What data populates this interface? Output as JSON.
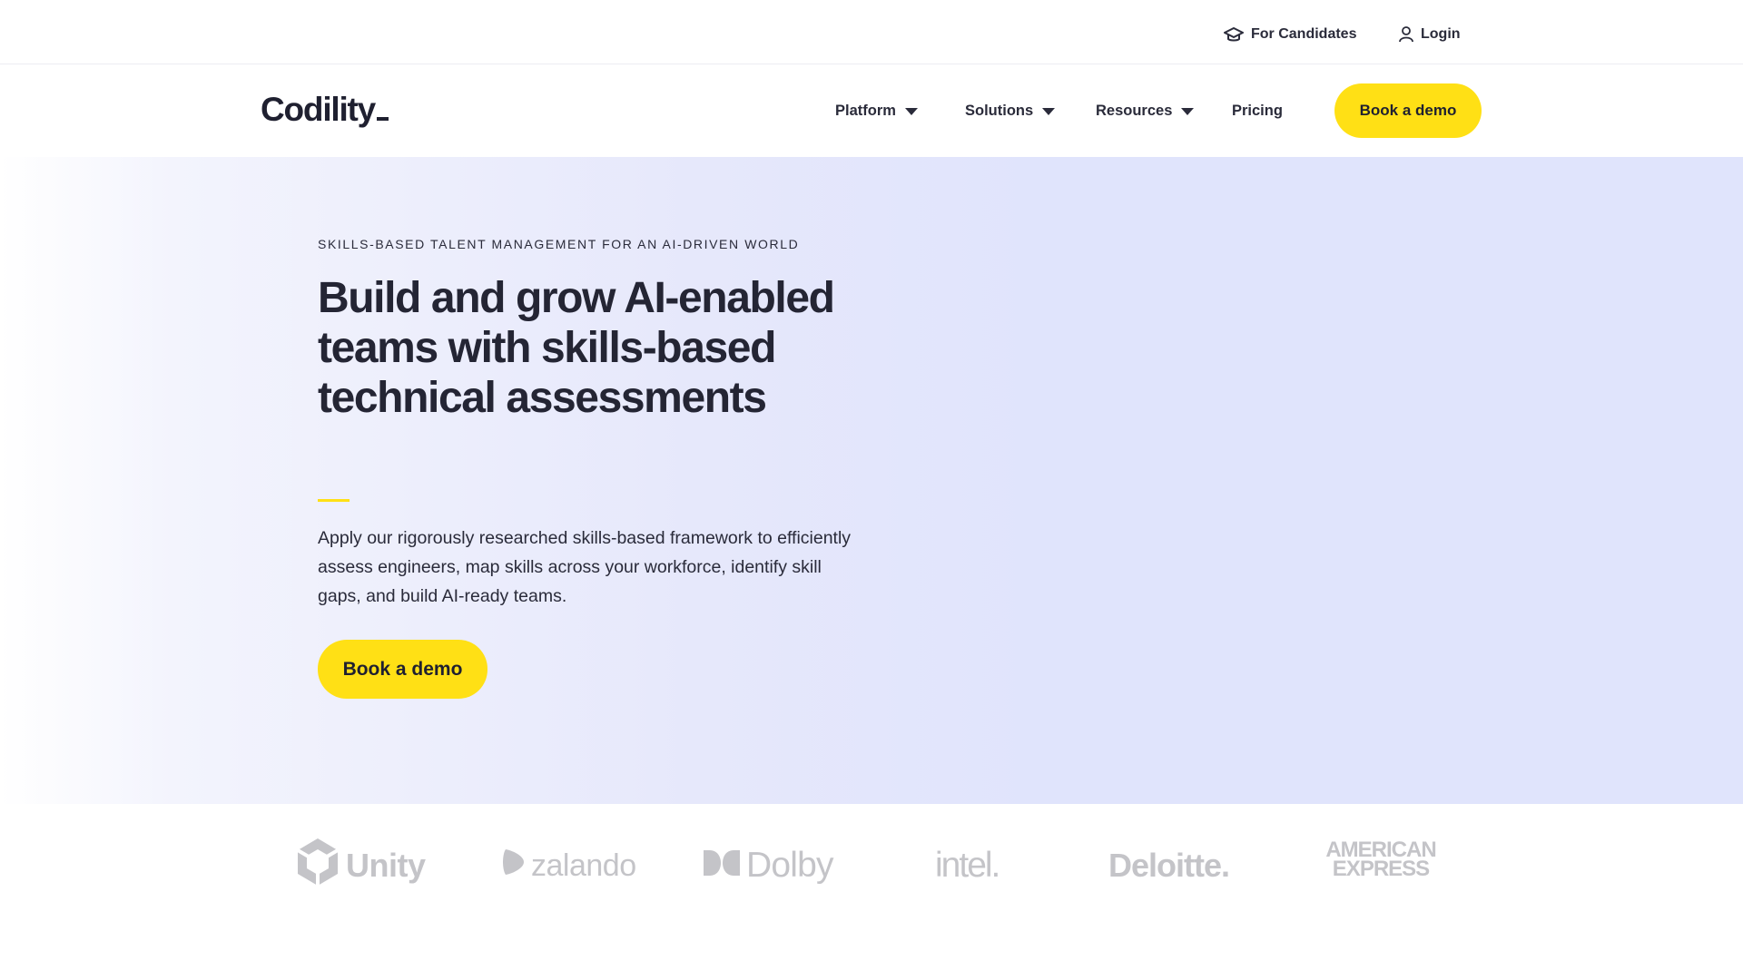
{
  "utility": {
    "for_candidates": "For Candidates",
    "login": "Login"
  },
  "nav": {
    "logo": "Codility",
    "items": [
      {
        "label": "Platform",
        "has_dropdown": true
      },
      {
        "label": "Solutions",
        "has_dropdown": true
      },
      {
        "label": "Resources",
        "has_dropdown": true
      },
      {
        "label": "Pricing",
        "has_dropdown": false
      }
    ],
    "cta": "Book a demo"
  },
  "hero": {
    "eyebrow": "SKILLS-BASED TALENT MANAGEMENT FOR AN AI-DRIVEN WORLD",
    "title": "Build and grow AI-enabled teams with skills-based technical assessments",
    "description": "Apply our rigorously researched skills-based framework to efficiently assess engineers, map skills across your workforce, identify skill gaps, and build AI-ready teams.",
    "cta": "Book a demo"
  },
  "customer_logos": [
    {
      "name": "Unity",
      "icon": "unity-cube-icon"
    },
    {
      "name": "zalando",
      "icon": "zalando-flag-icon"
    },
    {
      "name": "Dolby",
      "icon": "dolby-double-d-icon"
    },
    {
      "name": "intel.",
      "icon": null
    },
    {
      "name": "Deloitte.",
      "icon": null
    },
    {
      "name": "AMERICAN EXPRESS",
      "lines": [
        "AMERICAN",
        "EXPRESS"
      ],
      "icon": null
    }
  ],
  "colors": {
    "brand_yellow": "#ffe015",
    "text_dark": "#242534",
    "hero_bg": "#e0e4fc",
    "logo_gray": "#c4c4c8"
  }
}
